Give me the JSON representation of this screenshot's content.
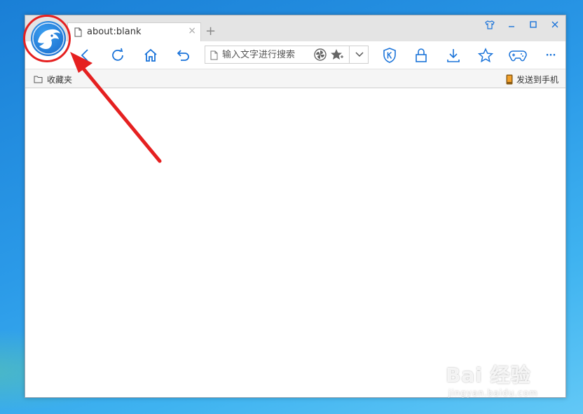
{
  "browser": {
    "tab": {
      "title": "about:blank",
      "close": "×"
    },
    "new_tab": "+",
    "window_controls": [
      "skin-icon",
      "minimize",
      "maximize",
      "close"
    ],
    "address_bar": {
      "placeholder": "输入文字进行搜索",
      "value": ""
    },
    "favorites_bar": {
      "folder_label": "收藏夹",
      "send_to_phone": "发送到手机"
    },
    "toolbar_icons": [
      "back",
      "refresh",
      "home",
      "undo",
      "shield-k",
      "lock",
      "download",
      "star",
      "gamepad",
      "more"
    ],
    "more_label": "···"
  },
  "watermark": {
    "main": "Bai  经验",
    "sub": "jingyan.baidu.com"
  },
  "colors": {
    "accent": "#1a73d9",
    "annotation": "#e52020",
    "desktop": "#2b9ae8"
  }
}
